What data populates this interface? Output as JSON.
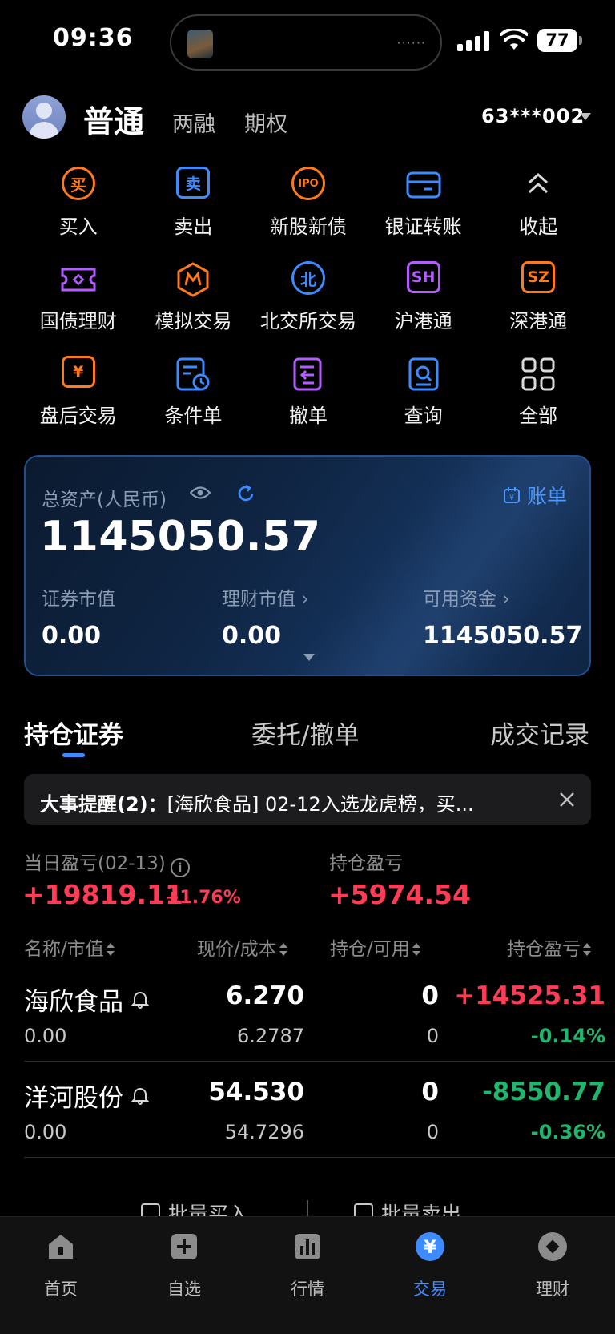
{
  "status_bar": {
    "time": "09:36",
    "battery": "77"
  },
  "header": {
    "tabs": [
      "普通",
      "两融",
      "期权"
    ],
    "account_id": "63***002"
  },
  "quick_actions": [
    [
      {
        "label": "买入",
        "icon": "buy-icon",
        "glyph": "买"
      },
      {
        "label": "卖出",
        "icon": "sell-icon",
        "glyph": "卖"
      },
      {
        "label": "新股新债",
        "icon": "ipo-icon",
        "glyph": "IPO"
      },
      {
        "label": "银证转账",
        "icon": "bank-transfer-icon",
        "glyph": ""
      },
      {
        "label": "收起",
        "icon": "collapse-icon",
        "glyph": ""
      }
    ],
    [
      {
        "label": "国债理财",
        "icon": "treasury-icon",
        "glyph": ""
      },
      {
        "label": "模拟交易",
        "icon": "simulate-icon",
        "glyph": ""
      },
      {
        "label": "北交所交易",
        "icon": "bse-icon",
        "glyph": "北"
      },
      {
        "label": "沪港通",
        "icon": "sh-connect-icon",
        "glyph": "SH"
      },
      {
        "label": "深港通",
        "icon": "sz-connect-icon",
        "glyph": "SZ"
      }
    ],
    [
      {
        "label": "盘后交易",
        "icon": "after-hours-icon",
        "glyph": "¥"
      },
      {
        "label": "条件单",
        "icon": "conditional-order-icon",
        "glyph": ""
      },
      {
        "label": "撤单",
        "icon": "cancel-order-icon",
        "glyph": ""
      },
      {
        "label": "查询",
        "icon": "query-icon",
        "glyph": ""
      },
      {
        "label": "全部",
        "icon": "all-icon",
        "glyph": ""
      }
    ]
  ],
  "assets": {
    "total_label": "总资产(人民币)",
    "total_value": "1145050.57",
    "bill_label": "账单",
    "securities_label": "证券市值",
    "securities_value": "0.00",
    "wealth_label": "理财市值",
    "wealth_value": "0.00",
    "available_label": "可用资金",
    "available_value": "1145050.57"
  },
  "position_tabs": [
    "持仓证券",
    "委托/撤单",
    "成交记录"
  ],
  "notice": {
    "title": "大事提醒(2)：",
    "text": "[海欣食品] 02-12入选龙虎榜，买..."
  },
  "pnl": {
    "daily_label": "当日盈亏(02-13)",
    "daily_value": "+19819.11",
    "daily_pct": "+1.76%",
    "holding_label": "持仓盈亏",
    "holding_value": "+5974.54"
  },
  "table": {
    "headers": [
      "名称/市值",
      "现价/成本",
      "持仓/可用",
      "持仓盈亏"
    ],
    "rows": [
      {
        "name": "海欣食品",
        "market_value": "0.00",
        "price": "6.270",
        "cost": "6.2787",
        "hold": "0",
        "available": "0",
        "pl": "+14525.31",
        "pl_pct": "-0.14%",
        "pl_dir": "up"
      },
      {
        "name": "洋河股份",
        "market_value": "0.00",
        "price": "54.530",
        "cost": "54.7296",
        "hold": "0",
        "available": "0",
        "pl": "-8550.77",
        "pl_pct": "-0.36%",
        "pl_dir": "down"
      }
    ]
  },
  "batch": {
    "buy": "批量买入",
    "sell": "批量卖出"
  },
  "bottom_nav": [
    {
      "label": "首页",
      "icon": "home-icon"
    },
    {
      "label": "自选",
      "icon": "watchlist-icon"
    },
    {
      "label": "行情",
      "icon": "market-icon"
    },
    {
      "label": "交易",
      "icon": "trade-icon",
      "active": true
    },
    {
      "label": "理财",
      "icon": "wealth-icon"
    }
  ],
  "colors": {
    "up": "#ff3b55",
    "down": "#21b66e",
    "accent": "#3d8bff",
    "orange": "#ff7a1a",
    "purple": "#b35cff"
  }
}
